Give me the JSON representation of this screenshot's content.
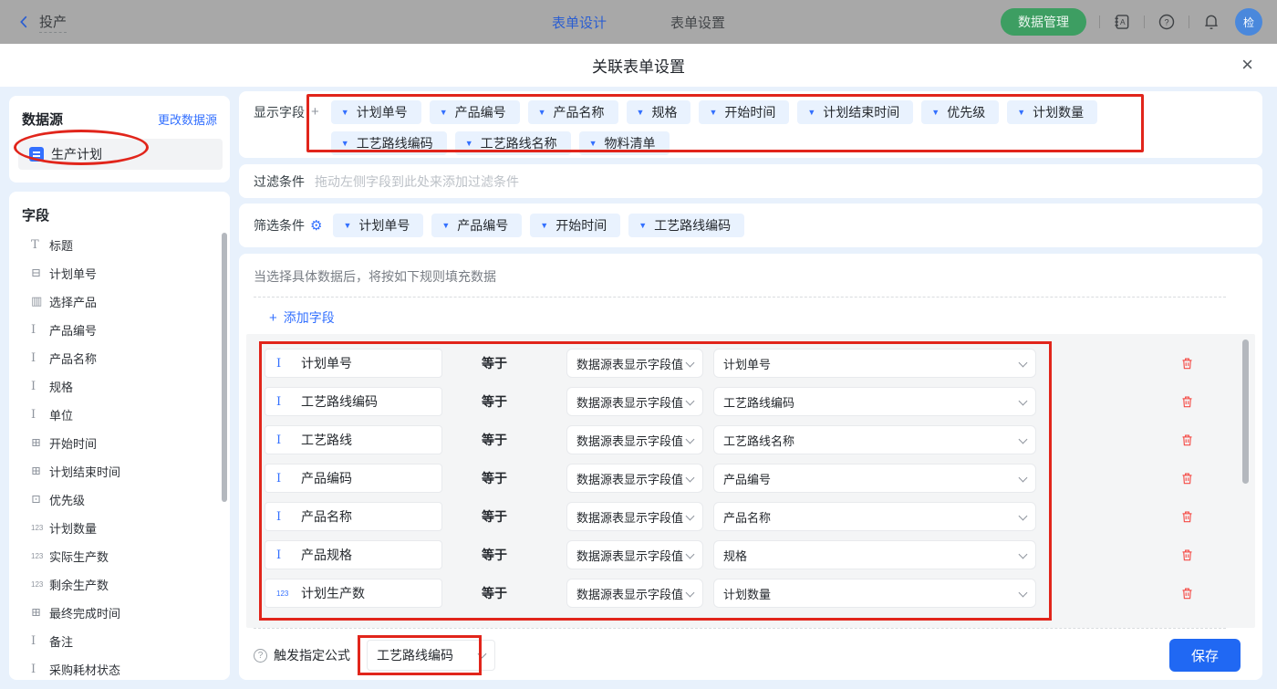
{
  "navbar": {
    "back_label": "投产",
    "tab_design": "表单设计",
    "tab_settings": "表单设置",
    "data_manage_label": "数据管理",
    "avatar_text": "检"
  },
  "modal_title": "关联表单设置",
  "sidebar": {
    "datasource_title": "数据源",
    "change_datasource_link": "更改数据源",
    "datasource_name": "生产计划",
    "fields_title": "字段",
    "fields": [
      {
        "icon": "title",
        "label": "标题"
      },
      {
        "icon": "serial",
        "label": "计划单号"
      },
      {
        "icon": "select",
        "label": "选择产品"
      },
      {
        "icon": "text",
        "label": "产品编号"
      },
      {
        "icon": "text",
        "label": "产品名称"
      },
      {
        "icon": "text",
        "label": "规格"
      },
      {
        "icon": "text",
        "label": "单位"
      },
      {
        "icon": "date",
        "label": "开始时间"
      },
      {
        "icon": "date",
        "label": "计划结束时间"
      },
      {
        "icon": "option",
        "label": "优先级"
      },
      {
        "icon": "number",
        "label": "计划数量"
      },
      {
        "icon": "number",
        "label": "实际生产数"
      },
      {
        "icon": "number",
        "label": "剩余生产数"
      },
      {
        "icon": "date",
        "label": "最终完成时间"
      },
      {
        "icon": "text",
        "label": "备注"
      },
      {
        "icon": "text",
        "label": "采购耗材状态"
      }
    ]
  },
  "icons": {
    "title": "T",
    "text": "I",
    "serial": "⊟",
    "select": "▥",
    "date": "⊞",
    "option": "⊡",
    "number": "123"
  },
  "display_fields": {
    "label": "显示字段",
    "chips": [
      "计划单号",
      "产品编号",
      "产品名称",
      "规格",
      "开始时间",
      "计划结束时间",
      "优先级",
      "计划数量",
      "工艺路线编码",
      "工艺路线名称",
      "物料清单"
    ]
  },
  "filter": {
    "label": "过滤条件",
    "placeholder": "拖动左侧字段到此处来添加过滤条件"
  },
  "screening": {
    "label": "筛选条件",
    "chips": [
      "计划单号",
      "产品编号",
      "开始时间",
      "工艺路线编码"
    ]
  },
  "rules": {
    "hint": "当选择具体数据后，将按如下规则填充数据",
    "add_field_label": "添加字段",
    "rows": [
      {
        "icon": "text",
        "field": "计划单号",
        "op": "等于",
        "source": "数据源表显示字段值",
        "value": "计划单号"
      },
      {
        "icon": "text",
        "field": "工艺路线编码",
        "op": "等于",
        "source": "数据源表显示字段值",
        "value": "工艺路线编码"
      },
      {
        "icon": "text",
        "field": "工艺路线",
        "op": "等于",
        "source": "数据源表显示字段值",
        "value": "工艺路线名称"
      },
      {
        "icon": "text",
        "field": "产品编码",
        "op": "等于",
        "source": "数据源表显示字段值",
        "value": "产品编号"
      },
      {
        "icon": "text",
        "field": "产品名称",
        "op": "等于",
        "source": "数据源表显示字段值",
        "value": "产品名称"
      },
      {
        "icon": "text",
        "field": "产品规格",
        "op": "等于",
        "source": "数据源表显示字段值",
        "value": "规格"
      },
      {
        "icon": "number",
        "field": "计划生产数",
        "op": "等于",
        "source": "数据源表显示字段值",
        "value": "计划数量"
      }
    ]
  },
  "footer": {
    "trigger_label": "触发指定公式",
    "trigger_value": "工艺路线编码",
    "save_label": "保存"
  },
  "colors": {
    "accent": "#3370ff",
    "annotation": "#e1251b",
    "save_button": "#2068f3",
    "data_manage_button": "#3d9e62",
    "delete": "#f54a45"
  }
}
